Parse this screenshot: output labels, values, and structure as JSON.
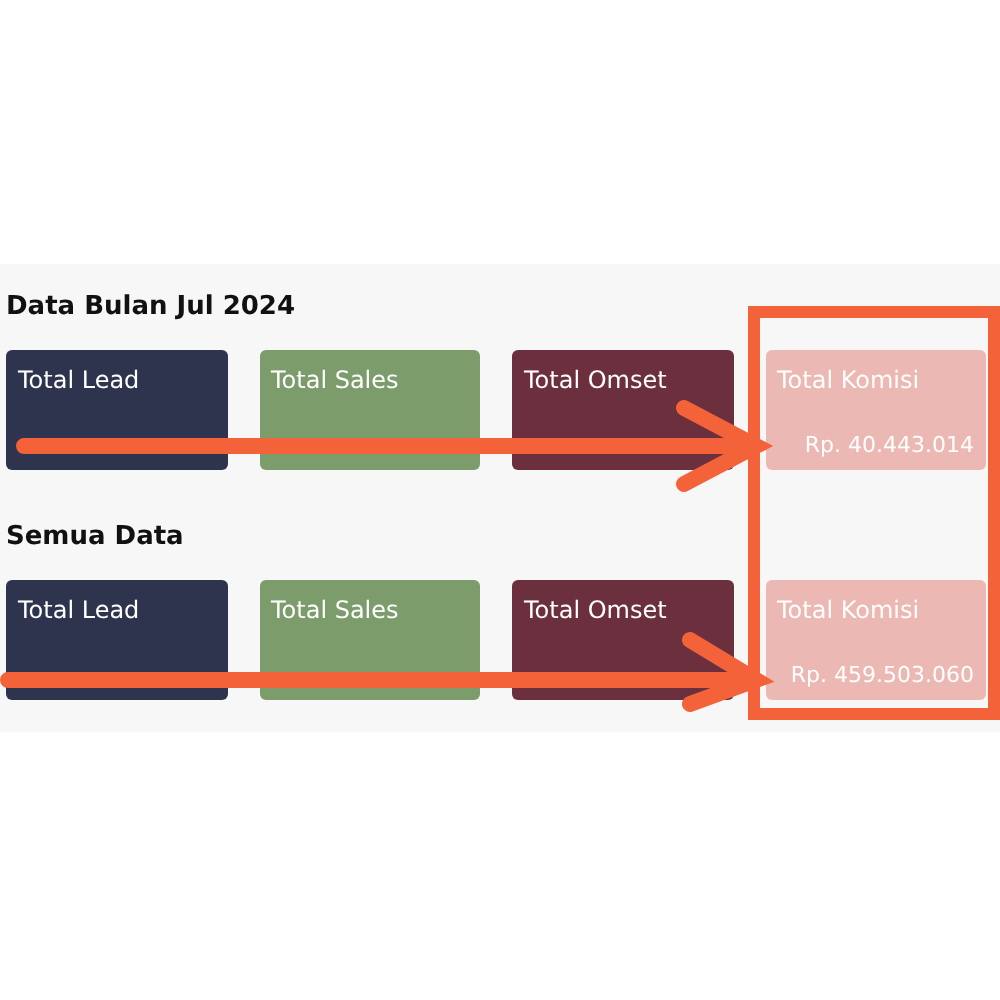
{
  "sections": [
    {
      "title": "Data Bulan Jul 2024",
      "cards": [
        {
          "label": "Total Lead",
          "color": "#2e344d"
        },
        {
          "label": "Total Sales",
          "color": "#7d9c6c"
        },
        {
          "label": "Total Omset",
          "color": "#6b2f3e"
        },
        {
          "label": "Total Komisi",
          "value": "Rp. 40.443.014",
          "color": "#ebb8b3"
        }
      ]
    },
    {
      "title": "Semua Data",
      "cards": [
        {
          "label": "Total Lead",
          "color": "#2e344d"
        },
        {
          "label": "Total Sales",
          "color": "#7d9c6c"
        },
        {
          "label": "Total Omset",
          "color": "#6b2f3e"
        },
        {
          "label": "Total Komisi",
          "value": "Rp. 459.503.060",
          "color": "#ebb8b3"
        }
      ]
    }
  ]
}
